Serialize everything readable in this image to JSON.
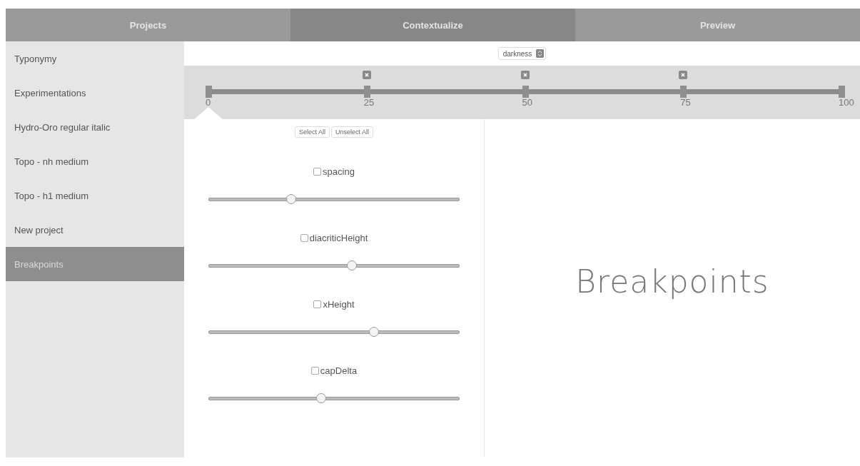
{
  "tabs": [
    {
      "label": "Projects",
      "selected": false
    },
    {
      "label": "Contextualize",
      "selected": true
    },
    {
      "label": "Preview",
      "selected": false
    }
  ],
  "sidebar": {
    "items": [
      {
        "label": "Typonymy",
        "selected": false
      },
      {
        "label": "Experimentations",
        "selected": false
      },
      {
        "label": "Hydro-Oro regular italic",
        "selected": false
      },
      {
        "label": "Topo - nh medium",
        "selected": false
      },
      {
        "label": "Topo - h1 medium",
        "selected": false
      },
      {
        "label": "New project",
        "selected": false
      },
      {
        "label": "Breakpoints",
        "selected": true
      }
    ]
  },
  "axis_select": {
    "value": "darkness"
  },
  "breakpoints": [
    {
      "label": "0",
      "removable": false,
      "selected": true
    },
    {
      "label": "25",
      "removable": true,
      "selected": false
    },
    {
      "label": "50",
      "removable": true,
      "selected": false
    },
    {
      "label": "75",
      "removable": true,
      "selected": false
    },
    {
      "label": "100",
      "removable": false,
      "selected": false
    }
  ],
  "buttons": [
    "Select All",
    "Unselect All"
  ],
  "parameters": [
    {
      "name": "spacing",
      "checked": false,
      "level": 0.33
    },
    {
      "name": "diacriticHeight",
      "checked": false,
      "level": 0.57
    },
    {
      "name": "xHeight",
      "checked": false,
      "level": 0.66
    },
    {
      "name": "capDelta",
      "checked": false,
      "level": 0.45
    }
  ],
  "preview": {
    "text": "Breakpoints"
  }
}
